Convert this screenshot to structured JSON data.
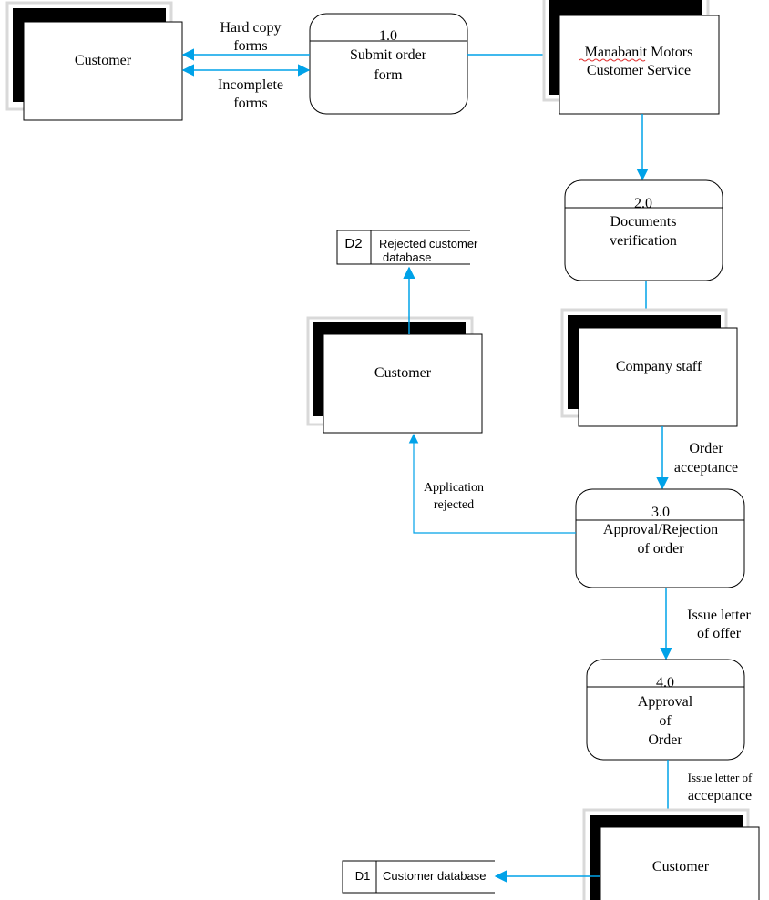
{
  "colors": {
    "flow": "#00a2e8",
    "outline": "#000000",
    "shadow": "#000000",
    "shadow_edge": "#d9d9d9"
  },
  "entities": {
    "customer_top": {
      "label": "Customer"
    },
    "customer_service": {
      "line1": "Manabanit Motors",
      "line2": "Customer Service"
    },
    "company_staff": {
      "label": "Company staff"
    },
    "customer_middle": {
      "label": "Customer"
    },
    "customer_bottom": {
      "label": "Customer"
    }
  },
  "processes": {
    "p1": {
      "id": "1.0",
      "line1": "Submit order",
      "line2": "form"
    },
    "p2": {
      "id": "2.0",
      "line1": "Documents",
      "line2": "verification"
    },
    "p3": {
      "id": "3.0",
      "line1": "Approval/Rejection",
      "line2": "of order"
    },
    "p4": {
      "id": "4.0",
      "line1": "Approval",
      "line2": "of",
      "line3": "Order"
    }
  },
  "stores": {
    "d2": {
      "id": "D2",
      "line1": "Rejected customer",
      "line2": "database"
    },
    "d1": {
      "id": "D1",
      "label": "Customer database"
    }
  },
  "flows": {
    "hard_copy": {
      "line1": "Hard copy",
      "line2": "forms"
    },
    "incomplete": {
      "line1": "Incomplete",
      "line2": "forms"
    },
    "order_acceptance": {
      "line1": "Order",
      "line2": "acceptance"
    },
    "application_rejected": {
      "line1": "Application",
      "line2": "rejected"
    },
    "letter_offer": {
      "line1": "Issue letter",
      "line2": "of offer"
    },
    "letter_acceptance": {
      "line1": "Issue letter of",
      "line2": "acceptance"
    }
  }
}
